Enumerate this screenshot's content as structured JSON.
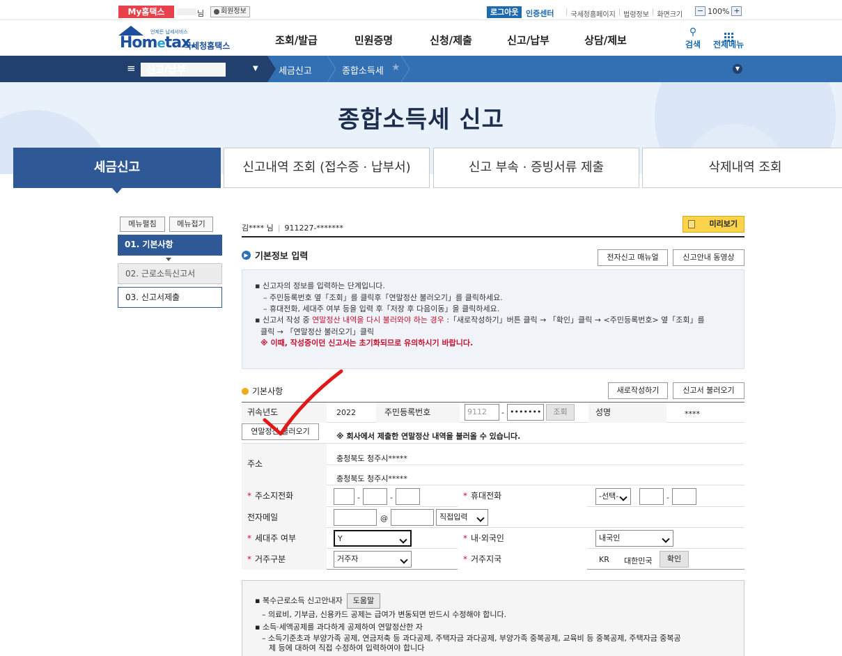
{
  "topbar": {
    "my_home": "My홈택스",
    "user_suffix": "님",
    "member_info": "회원정보",
    "logout": "로그아웃",
    "cert_center": "인증센터",
    "links": [
      "국세청홈페이지",
      "법령정보",
      "화면크기"
    ],
    "zoom_minus": "−",
    "zoom_value": "100%",
    "zoom_plus": "+"
  },
  "header": {
    "logo_tag": "언제든 납세서비스",
    "logo_home": "Hom",
    "logo_e": "e",
    "logo_tax": "tax.",
    "logo_kr": "국세청홈택스",
    "gnb": [
      "조회/발급",
      "민원증명",
      "신청/제출",
      "신고/납부",
      "상담/제보"
    ],
    "search": "검색",
    "all_menu": "전체메뉴"
  },
  "navbar": {
    "menu_label": "신고/납부",
    "crumb1": "세금신고",
    "crumb2": "종합소득세"
  },
  "banner": {
    "title": "종합소득세 신고"
  },
  "tabs": [
    "세금신고",
    "신고내역 조회 (접수증 · 납부서)",
    "신고 부속 · 증빙서류 제출",
    "삭제내역 조회"
  ],
  "side": {
    "edit_menu": "메뉴펼침",
    "fold_menu": "메뉴접기",
    "items": [
      "01. 기본사항",
      "02. 근로소득신고서",
      "03. 신고서제출"
    ]
  },
  "user": {
    "name": "김**** 님",
    "rrn": "911227-*******",
    "preview": "미리보기"
  },
  "basic_info": {
    "title": "기본정보 입력",
    "manual_btn": "전자신고 매뉴얼",
    "video_btn": "신고안내 동영상",
    "lines": {
      "l1": "신고자의 정보를 입력하는 단계입니다.",
      "l2": "– 주민등록번호 옆「조회」를 클릭후「연말정산 불러오기」를 클릭하세요.",
      "l3": "– 휴대전화, 세대주 여부 등을 입력 후「저장 후 다음이동」을 클릭하세요.",
      "l4a": "신고서 작성 중 ",
      "l4b": "연말정산 내역을 다시 불러와야 하는 경우",
      "l4c": " :「새로작성하기」버튼 클릭 → 「확인」클릭 → <주민등록번호> 옆「조회」를",
      "l5": "클릭 → 「연말정산 불러오기」클릭",
      "l6": "※ 이때, 작성중이던 신고서는 초기화되므로 유의하시기 바랍니다."
    }
  },
  "basic": {
    "title": "기본사항",
    "new_btn": "새로작성하기",
    "load_btn": "신고서 불러오기",
    "year_label": "귀속년도",
    "year_value": "2022",
    "rrn_label": "주민등록번호",
    "rrn_front": "9112",
    "rrn_back": "•••••••",
    "lookup_btn": "조회",
    "name_label": "성명",
    "name_value": "****",
    "yearend_btn": "연말정산 불러오기",
    "yearend_note": "※ 회사에서 제출한 연말정산 내역을 불러올 수 있습니다.",
    "addr_label": "주소",
    "addr1": "충청북도 청주시*****",
    "addr2": "충청북도 청주시*****",
    "home_phone_label": "주소지전화",
    "mobile_label": "휴대전화",
    "mobile_select": "-선택-",
    "email_label": "전자메일",
    "email_at": "@",
    "email_direct": "직접입력",
    "household_label": "세대주 여부",
    "household_value": "Y",
    "nationality_label": "내·외국인",
    "nationality_value": "내국인",
    "residence_label": "거주구분",
    "residence_value": "거주자",
    "country_label": "거주지국",
    "country_code": "KR",
    "country_name": "대한민국",
    "confirm_btn": "확인",
    "dash": "-"
  },
  "bottom": {
    "b1": "복수근로소득 신고안내자",
    "help_btn": "도움말",
    "b1s": "– 의료비, 기부금, 신용카드 공제는 급여가 변동되면 반드시 수정해야 합니다.",
    "b2": "소득·세액공제를 과다하게 공제하여 연말정산한 자",
    "b2s": "– 소득기준초과 부양가족 공제, 연금저축 등 과다공제, 주택자금 과다공제, 부양가족 중복공제, 교육비 등 중복공제, 주택자금 중복공",
    "b2s2": "제 등에 대하여 직접 수정하여 입력하여야 합니다"
  },
  "colors": {
    "primary": "#2e5996",
    "nav": "#3370b3",
    "red": "#c8102e",
    "preview": "#fbd44b"
  }
}
